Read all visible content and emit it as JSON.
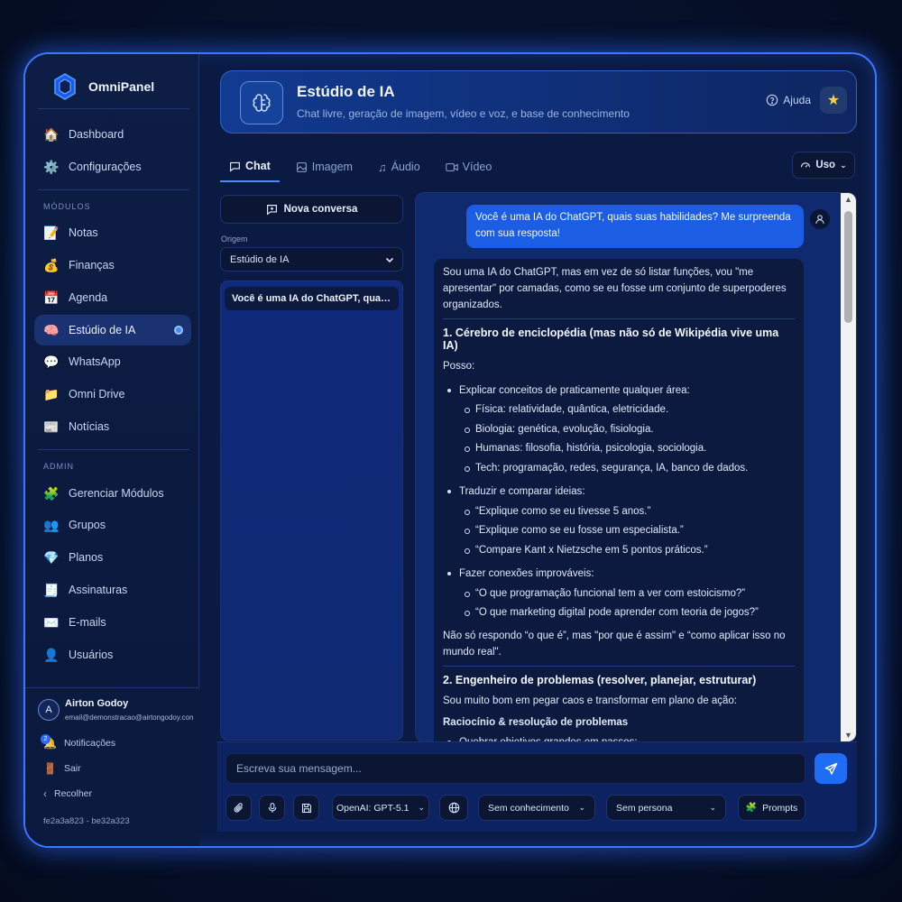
{
  "brand": {
    "name": "OmniPanel"
  },
  "sidebar": {
    "nav": [
      {
        "label": "Dashboard",
        "icon": "house-icon"
      },
      {
        "label": "Configurações",
        "icon": "gear-icon"
      }
    ],
    "modules_label": "MÓDULOS",
    "modules": [
      {
        "label": "Notas",
        "icon": "memo-icon"
      },
      {
        "label": "Finanças",
        "icon": "money-bag-icon"
      },
      {
        "label": "Agenda",
        "icon": "calendar-icon"
      },
      {
        "label": "Estúdio de IA",
        "icon": "brain-icon",
        "active": true
      },
      {
        "label": "WhatsApp",
        "icon": "speech-bubble-icon"
      },
      {
        "label": "Omni Drive",
        "icon": "folder-icon"
      },
      {
        "label": "Notícias",
        "icon": "newspaper-icon"
      }
    ],
    "admin_label": "ADMIN",
    "admin": [
      {
        "label": "Gerenciar Módulos",
        "icon": "puzzle-icon"
      },
      {
        "label": "Grupos",
        "icon": "people-icon"
      },
      {
        "label": "Planos",
        "icon": "gem-icon"
      },
      {
        "label": "Assinaturas",
        "icon": "receipt-icon"
      },
      {
        "label": "E-mails",
        "icon": "envelope-icon"
      },
      {
        "label": "Usuários",
        "icon": "person-icon"
      }
    ],
    "user": {
      "initial": "A",
      "name": "Airton Godoy",
      "email": "email@demonstracao@airtongodoy.com.br"
    },
    "notifications": {
      "label": "Notificações",
      "count": "2"
    },
    "logout_label": "Sair",
    "collapse_label": "Recolher",
    "build": "fe2a3a823 - be32a323"
  },
  "header": {
    "title": "Estúdio de IA",
    "subtitle": "Chat livre, geração de imagem, vídeo e voz, e base de conhecimento",
    "help_label": "Ajuda"
  },
  "tabs": [
    {
      "label": "Chat",
      "icon": "chat-icon",
      "active": true
    },
    {
      "label": "Imagem",
      "icon": "image-icon"
    },
    {
      "label": "Áudio",
      "icon": "music-note-icon"
    },
    {
      "label": "Vídeo",
      "icon": "video-camera-icon"
    }
  ],
  "usage_button": "Uso",
  "left_panel": {
    "new_conversation": "Nova conversa",
    "origin_label": "Origem",
    "origin_value": "Estúdio de IA",
    "conversations": [
      {
        "title": "Você é uma IA do ChatGPT, quais suas habilidades?"
      }
    ]
  },
  "chat": {
    "user_message": "Você é uma IA do ChatGPT, quais suas habilidades? Me surpreenda com sua resposta!",
    "ai": {
      "intro": "Sou uma IA do ChatGPT, mas em vez de só listar funções, vou \"me apresentar\" por camadas, como se eu fosse um conjunto de superpoderes organizados.",
      "section1_title": "1. Cérebro de enciclopédia (mas não só de Wikipédia vive uma IA)",
      "section1_lead": "Posso:",
      "b1": "Explicar conceitos de praticamente qualquer área:",
      "b1_subs": [
        "Física: relatividade, quântica, eletricidade.",
        "Biologia: genética, evolução, fisiologia.",
        "Humanas: filosofia, história, psicologia, sociologia.",
        "Tech: programação, redes, segurança, IA, banco de dados."
      ],
      "b2": "Traduzir e comparar ideias:",
      "b2_subs": [
        "“Explique como se eu tivesse 5 anos.”",
        "“Explique como se eu fosse um especialista.”",
        "“Compare Kant x Nietzsche em 5 pontos práticos.”"
      ],
      "b3": "Fazer conexões improváveis:",
      "b3_subs": [
        "“O que programação funcional tem a ver com estoicismo?”",
        "“O que marketing digital pode aprender com teoria de jogos?”"
      ],
      "section1_close": "Não só respondo “o que é”, mas \"por que é assim\" e “como aplicar isso no mundo real\".",
      "section2_title": "2. Engenheiro de problemas (resolver, planejar, estruturar)",
      "section2_lead": "Sou muito bom em pegar caos e transformar em plano de ação:",
      "section2_sub": "Raciocínio & resolução de problemas",
      "section2_b1": "Quebrar objetivos grandes em passos:"
    }
  },
  "composer": {
    "placeholder": "Escreva sua mensagem...",
    "model": "OpenAI: GPT-5.1",
    "knowledge": "Sem conhecimento",
    "persona": "Sem persona",
    "prompts": "Prompts"
  }
}
